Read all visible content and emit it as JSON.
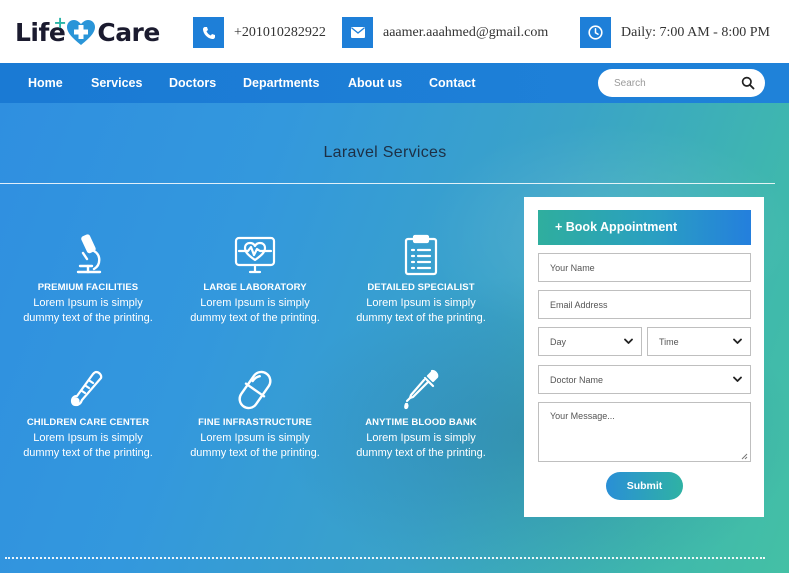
{
  "header": {
    "logo_left": "Life",
    "logo_right": "Care",
    "phone": "+201010282922",
    "email": "aaamer.aaahmed@gmail.com",
    "hours": "Daily: 7:00 AM - 8:00 PM",
    "icons": {
      "phone": "phone-icon",
      "email": "envelope-icon",
      "hours": "clock-icon"
    }
  },
  "nav": {
    "items": [
      "Home",
      "Services",
      "Doctors",
      "Departments",
      "About us",
      "Contact"
    ],
    "search_placeholder": "Search"
  },
  "hero": {
    "title": "Laravel Services",
    "features": [
      {
        "icon": "microscope-icon",
        "title": "PREMIUM FACILITIES",
        "line1": "Lorem Ipsum is simply",
        "line2": "dummy text of the printing."
      },
      {
        "icon": "heart-monitor-icon",
        "title": "LARGE LABORATORY",
        "line1": "Lorem Ipsum is simply",
        "line2": "dummy text of the printing."
      },
      {
        "icon": "clipboard-icon",
        "title": "DETAILED SPECIALIST",
        "line1": "Lorem Ipsum is simply",
        "line2": "dummy text of the printing."
      },
      {
        "icon": "thermometer-icon",
        "title": "CHILDREN CARE CENTER",
        "line1": "Lorem Ipsum is simply",
        "line2": "dummy text of the printing."
      },
      {
        "icon": "pill-icon",
        "title": "FINE INFRASTRUCTURE",
        "line1": "Lorem Ipsum is simply",
        "line2": "dummy text of the printing."
      },
      {
        "icon": "dropper-icon",
        "title": "ANYTIME BLOOD BANK",
        "line1": "Lorem Ipsum is simply",
        "line2": "dummy text of the printing."
      }
    ]
  },
  "booking": {
    "title": "+ Book Appointment",
    "name_placeholder": "Your Name",
    "email_placeholder": "Email Address",
    "day_selected": "Day",
    "time_selected": "Time",
    "doctor_selected": "Doctor Name",
    "message_placeholder": "Your Message...",
    "submit": "Submit"
  },
  "colors": {
    "brand_blue": "#1e7fd8",
    "brand_teal": "#2fb2a4",
    "logo_dark": "#1b1b2f"
  }
}
